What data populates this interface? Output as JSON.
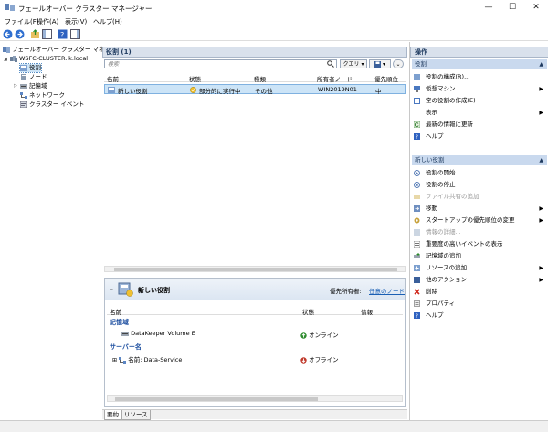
{
  "window": {
    "title": "フェールオーバー クラスター マネージャー",
    "minimize": "—",
    "maximize": "☐",
    "close": "✕"
  },
  "menu": [
    "ファイル(F)",
    "操作(A)",
    "表示(V)",
    "ヘルプ(H)"
  ],
  "tree": {
    "root": "フェールオーバー クラスター マネージャー",
    "cluster": "WSFC-CLUSTER.lk.local",
    "items": [
      "役割",
      "ノード",
      "記憶域",
      "ネットワーク",
      "クラスター イベント"
    ]
  },
  "roles_panel": {
    "title": "役割 (1)",
    "search_placeholder": "検索",
    "query_label": "クエリ",
    "columns": [
      "名前",
      "状態",
      "種類",
      "所有者ノード",
      "優先順位"
    ],
    "rows": [
      {
        "name": "新しい役割",
        "status": "部分的に実行中",
        "type": "その他",
        "owner": "WIN2019N01",
        "priority": "中"
      }
    ]
  },
  "detail": {
    "title": "新しい役割",
    "preferred_owner_label": "優先所有者:",
    "preferred_owner_link": "任意のノード",
    "columns": [
      "名前",
      "状態",
      "情報"
    ],
    "groups": [
      {
        "name": "記憶域",
        "items": [
          {
            "name": "DataKeeper Volume E",
            "status": "オンライン"
          }
        ]
      },
      {
        "name": "サーバー名",
        "items": [
          {
            "name": "名前: Data-Service",
            "status": "オフライン"
          }
        ]
      }
    ],
    "tabs": [
      "要約",
      "リソース"
    ]
  },
  "actions": {
    "title": "操作",
    "section1": {
      "label": "役割",
      "items": [
        {
          "label": "役割の構成(R)...",
          "arrow": false,
          "disabled": false
        },
        {
          "label": "仮想マシン...",
          "arrow": true,
          "disabled": false
        },
        {
          "label": "空の役割の作成(E)",
          "arrow": false,
          "disabled": false
        },
        {
          "label": "表示",
          "arrow": true,
          "disabled": false
        },
        {
          "label": "最新の情報に更新",
          "arrow": false,
          "disabled": false
        },
        {
          "label": "ヘルプ",
          "arrow": false,
          "disabled": false
        }
      ]
    },
    "section2": {
      "label": "新しい役割",
      "items": [
        {
          "label": "役割の開始",
          "arrow": false,
          "disabled": false
        },
        {
          "label": "役割の停止",
          "arrow": false,
          "disabled": false
        },
        {
          "label": "ファイル共有の追加",
          "arrow": false,
          "disabled": true
        },
        {
          "label": "移動",
          "arrow": true,
          "disabled": false
        },
        {
          "label": "スタートアップの優先順位の変更",
          "arrow": true,
          "disabled": false
        },
        {
          "label": "情報の詳細...",
          "arrow": false,
          "disabled": true
        },
        {
          "label": "重要度の高いイベントの表示",
          "arrow": false,
          "disabled": false
        },
        {
          "label": "記憶域の追加",
          "arrow": false,
          "disabled": false
        },
        {
          "label": "リソースの追加",
          "arrow": true,
          "disabled": false
        },
        {
          "label": "他のアクション",
          "arrow": true,
          "disabled": false
        },
        {
          "label": "削除",
          "arrow": false,
          "disabled": false
        },
        {
          "label": "プロパティ",
          "arrow": false,
          "disabled": false
        },
        {
          "label": "ヘルプ",
          "arrow": false,
          "disabled": false
        }
      ]
    }
  },
  "colors": {
    "selection": "#cce4f7",
    "panel_header": "#d9e1ec",
    "section": "#c9d9ee",
    "link": "#1a5fb4",
    "online": "#2e8b2e",
    "offline": "#c0392b"
  }
}
